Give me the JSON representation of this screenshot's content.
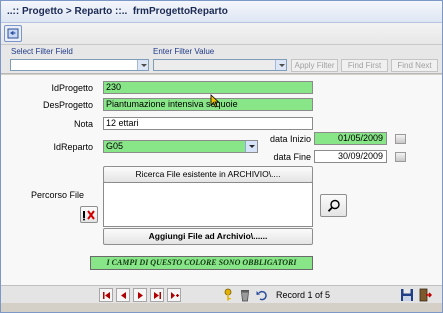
{
  "window": {
    "title": "..:: Progetto > Reparto ::..  frmProgettoReparto"
  },
  "filter": {
    "field_label": "Select Filter Field",
    "value_label": "Enter Filter Value",
    "apply_label": "Apply Filter",
    "find_first_label": "Find First",
    "find_next_label": "Find Next"
  },
  "form": {
    "id_progetto_label": "IdProgetto",
    "id_progetto_value": "230",
    "des_progetto_label": "DesProgetto",
    "des_progetto_value": "Piantumazione intensiva sequoie",
    "nota_label": "Nota",
    "nota_value": "12 ettari",
    "data_inizio_label": "data Inizio",
    "data_inizio_value": "01/05/2009",
    "data_fine_label": "data Fine",
    "data_fine_value": "30/09/2009",
    "id_reparto_label": "IdReparto",
    "id_reparto_value": "G05",
    "search_file_label": "Ricerca File esistente in ARCHIVIO\\....",
    "percorso_label": "Percorso File",
    "add_file_label": "Aggiungi File ad Archivio\\......",
    "notice": "I CAMPI DI QUESTO COLORE SONO OBBLIGATORI"
  },
  "nav": {
    "record_text": "Record 1 of 5"
  },
  "colors": {
    "required_field": "#88e588",
    "label_blue": "#203c8a"
  }
}
